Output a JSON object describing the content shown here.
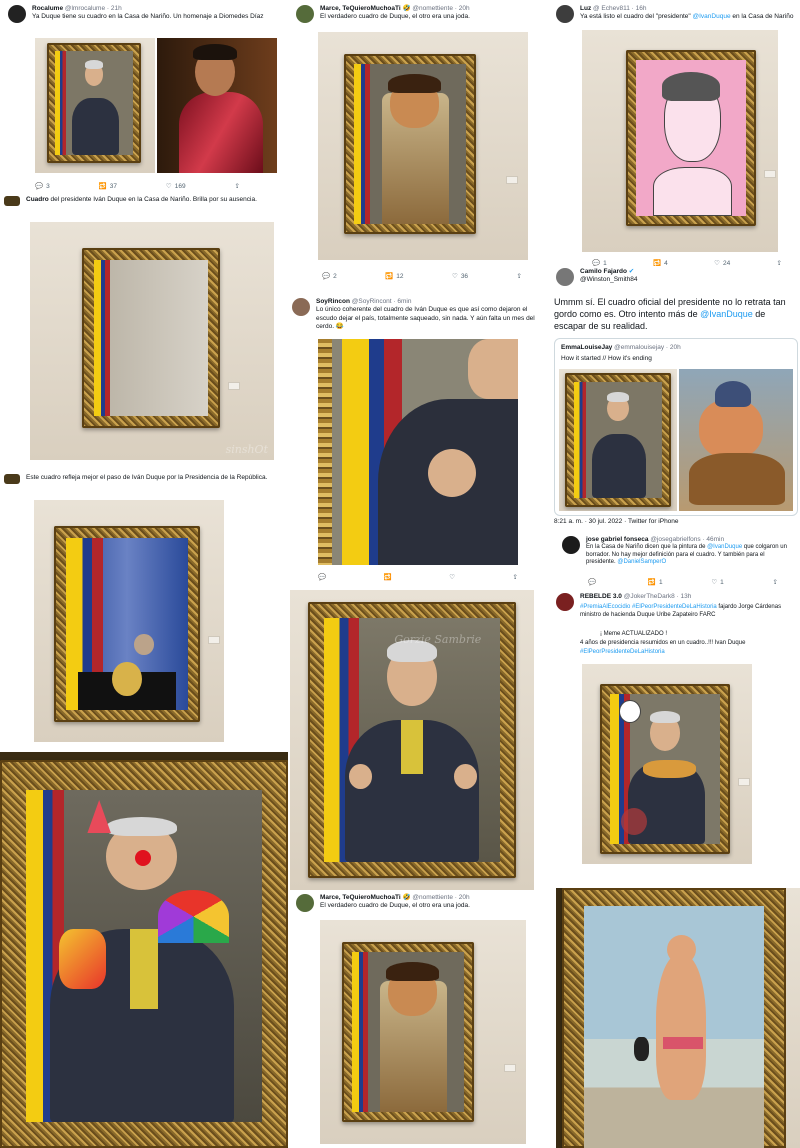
{
  "t1": {
    "name": "Rocalume",
    "handle": "@lmrocalume · 21h",
    "text": "Ya Duque tiene su cuadro en la Casa de Nariño. Un homenaje a Diomedes Díaz",
    "reply": "3",
    "retweet": "37",
    "like": "169"
  },
  "t2": {
    "name": "Marce, TeQuieroMuchoaTi 🤣",
    "handle": "@nomettiente · 20h",
    "text": "El verdadero cuadro de Duque, el otro era una joda.",
    "reply": "2",
    "retweet": "12",
    "like": "36"
  },
  "t3": {
    "name": "Luz",
    "handle": "@ Echev811 · 16h",
    "text_a": "Ya está listo el cuadro del \"presidente\" ",
    "mention": "@IvanDuque",
    "text_b": " en la Casa de Nariño",
    "reply": "1",
    "retweet": "4",
    "like": "24"
  },
  "t4": {
    "name": "Cuadro",
    "text": " del presidente Iván Duque en la Casa de Nariño. Brilla por su ausencia.",
    "watermark": "sinshOt"
  },
  "t5": {
    "name": "SoyRincon",
    "handle": "@SoyRincont · 6min",
    "text": "Lo único coherente del cuadro de Iván Duque es que así como dejaron el escudo dejar el país, totalmente saqueado, sin nada. Y aún falta un mes del cerdo. 😂"
  },
  "t6": {
    "name": "Camilo Fajardo",
    "verified": "✔",
    "handle": "@Winston_Smith84",
    "text_a": "Ummm sí. El cuadro oficial del presidente no lo retrata tan gordo como es. Otro intento más de ",
    "mention": "@IvanDuque",
    "text_b": " de escapar de su realidad.",
    "quote_name": "EmmaLouiseJay",
    "quote_handle": "@emmalouisejay · 20h",
    "quote_text": "How it started // How it's ending",
    "time": "8:21 a. m. · 30 jul. 2022 · Twitter for iPhone"
  },
  "t7": {
    "text": "Este cuadro refleja mejor el paso de Iván Duque por la Presidencia de la República."
  },
  "t8": {
    "name": "jose gabriel fonseca",
    "handle": "@josegabrielfons · 46min",
    "text_a": "En la Casa de Nariño dicen que la pintura de ",
    "mention": "@IvanDuque",
    "text_b": " que colgaron un borrador. No hay mejor definición para el cuadro. Y también para el presidente. ",
    "mention2": "@DanielSamperO",
    "reply": "",
    "retweet": "1",
    "like": "1"
  },
  "t9": {
    "name": "REBELDE 3.0",
    "handle": "@JokerTheDark8 · 13h",
    "text_a": "#PremiaAlEcocidio #ElPeorPresidenteDeLaHistoria",
    "text_b": " fajardo Jorge Cárdenas ministro de hacienda Duque Uribe Zapateiro FARC",
    "text_c": "¡ Meme ACTUALIZADO !",
    "text_d": "4 años de presidencia resumidos en un cuadro..!!!  Ivan Duque",
    "text_e": "#ElPeorPresidenteDeLaHistoria"
  },
  "t10": {
    "name": "Marce, TeQuieroMuchoaTi 🤣",
    "handle": "@nomettiente · 20h",
    "text": "El verdadero cuadro de Duque, el otro era una joda."
  },
  "watermark_main": "Gorzie Sambrie",
  "colors": {
    "link": "#1d9bf0",
    "gold": "#c9a14d",
    "wall": "#e9e2d6"
  }
}
